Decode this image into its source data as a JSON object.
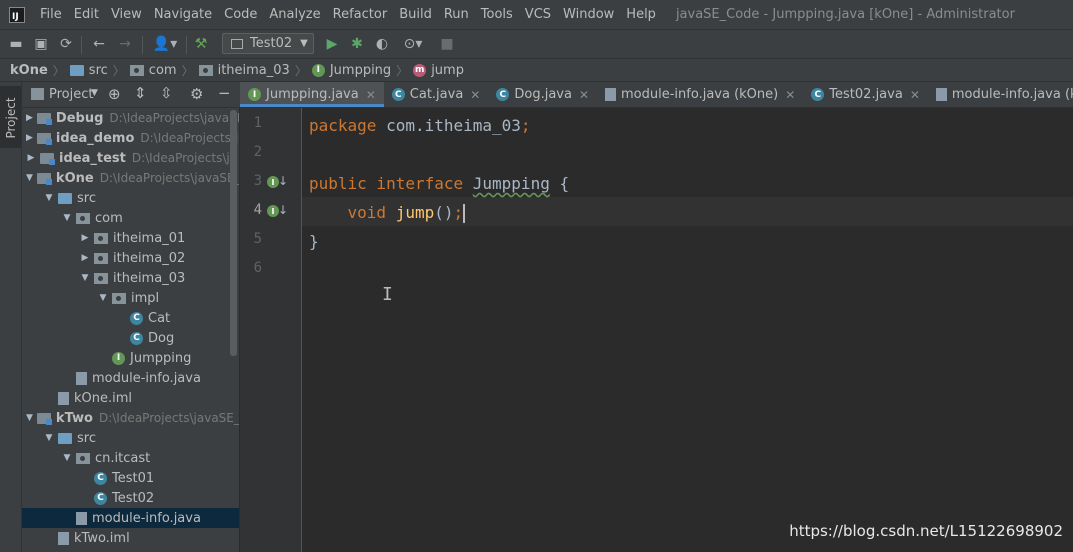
{
  "window": {
    "title": "javaSE_Code - Jumpping.java [kOne] - Administrator",
    "logo_text": "IJ"
  },
  "menu": [
    "File",
    "Edit",
    "View",
    "Navigate",
    "Code",
    "Analyze",
    "Refactor",
    "Build",
    "Run",
    "Tools",
    "VCS",
    "Window",
    "Help"
  ],
  "toolbar": {
    "run_config": "Test02",
    "icons": [
      "open-icon",
      "save-icon",
      "sync-icon",
      "back-icon",
      "forward-icon",
      "user-dropdown-icon",
      "build-hammer-icon",
      "run-icon",
      "debug-icon",
      "coverage-icon",
      "profile-icon",
      "stop-icon"
    ]
  },
  "breadcrumb": [
    "kOne",
    "src",
    "com",
    "itheima_03",
    "Jumpping",
    "jump"
  ],
  "project_panel": {
    "title": "Project",
    "strip_label": "Project",
    "tree": [
      {
        "name": "Debug",
        "path": "D:\\IdeaProjects\\javaSE",
        "icon": "module",
        "arrow": "right",
        "depth": 0,
        "bold": true
      },
      {
        "name": "idea_demo",
        "path": "D:\\IdeaProjects\\ja",
        "icon": "module",
        "arrow": "right",
        "depth": 0,
        "bold": true
      },
      {
        "name": "idea_test",
        "path": "D:\\IdeaProjects\\ja",
        "icon": "module",
        "arrow": "right",
        "depth": 0,
        "bold": true
      },
      {
        "name": "kOne",
        "path": "D:\\IdeaProjects\\javaSE_",
        "icon": "module",
        "arrow": "down",
        "depth": 0,
        "bold": true
      },
      {
        "name": "src",
        "path": "",
        "icon": "folder-blue",
        "arrow": "down",
        "depth": 1,
        "bold": false
      },
      {
        "name": "com",
        "path": "",
        "icon": "package",
        "arrow": "down",
        "depth": 2,
        "bold": false
      },
      {
        "name": "itheima_01",
        "path": "",
        "icon": "package",
        "arrow": "right",
        "depth": 3,
        "bold": false
      },
      {
        "name": "itheima_02",
        "path": "",
        "icon": "package",
        "arrow": "right",
        "depth": 3,
        "bold": false
      },
      {
        "name": "itheima_03",
        "path": "",
        "icon": "package",
        "arrow": "down",
        "depth": 3,
        "bold": false
      },
      {
        "name": "impl",
        "path": "",
        "icon": "package",
        "arrow": "down",
        "depth": 4,
        "bold": false
      },
      {
        "name": "Cat",
        "path": "",
        "icon": "class",
        "arrow": "none",
        "depth": 5,
        "bold": false
      },
      {
        "name": "Dog",
        "path": "",
        "icon": "class",
        "arrow": "none",
        "depth": 5,
        "bold": false
      },
      {
        "name": "Jumpping",
        "path": "",
        "icon": "interface",
        "arrow": "none",
        "depth": 4,
        "bold": false
      },
      {
        "name": "module-info.java",
        "path": "",
        "icon": "file",
        "arrow": "none",
        "depth": 2,
        "bold": false
      },
      {
        "name": "kOne.iml",
        "path": "",
        "icon": "file",
        "arrow": "none",
        "depth": 1,
        "bold": false
      },
      {
        "name": "kTwo",
        "path": "D:\\IdeaProjects\\javaSE_",
        "icon": "module",
        "arrow": "down",
        "depth": 0,
        "bold": true
      },
      {
        "name": "src",
        "path": "",
        "icon": "folder-blue",
        "arrow": "down",
        "depth": 1,
        "bold": false
      },
      {
        "name": "cn.itcast",
        "path": "",
        "icon": "package",
        "arrow": "down",
        "depth": 2,
        "bold": false
      },
      {
        "name": "Test01",
        "path": "",
        "icon": "class",
        "arrow": "none",
        "depth": 3,
        "bold": false
      },
      {
        "name": "Test02",
        "path": "",
        "icon": "class",
        "arrow": "none",
        "depth": 3,
        "bold": false
      },
      {
        "name": "module-info.java",
        "path": "",
        "icon": "file",
        "arrow": "none",
        "depth": 2,
        "bold": false,
        "selected": true
      },
      {
        "name": "kTwo.iml",
        "path": "",
        "icon": "file",
        "arrow": "none",
        "depth": 1,
        "bold": false
      }
    ]
  },
  "editor_tabs": [
    {
      "label": "Jumpping.java",
      "icon": "interface",
      "active": true
    },
    {
      "label": "Cat.java",
      "icon": "class",
      "active": false
    },
    {
      "label": "Dog.java",
      "icon": "class",
      "active": false
    },
    {
      "label": "module-info.java (kOne)",
      "icon": "file",
      "active": false
    },
    {
      "label": "Test02.java",
      "icon": "class",
      "active": false
    },
    {
      "label": "module-info.java (kTwo)",
      "icon": "file",
      "active": false
    }
  ],
  "code": {
    "line_numbers": [
      "1",
      "2",
      "3",
      "4",
      "5",
      "6"
    ],
    "lines": [
      {
        "parts": [
          {
            "t": "package ",
            "c": "kw"
          },
          {
            "t": "com.itheima_03",
            "c": "plain"
          },
          {
            "t": ";",
            "c": "kw"
          }
        ]
      },
      {
        "parts": []
      },
      {
        "parts": [
          {
            "t": "public interface ",
            "c": "kw"
          },
          {
            "t": "Jumpping",
            "c": "type-name"
          },
          {
            "t": " {",
            "c": "plain"
          }
        ]
      },
      {
        "parts": [
          {
            "t": "    void ",
            "c": "kw"
          },
          {
            "t": "jump",
            "c": "method-name"
          },
          {
            "t": "()",
            "c": "plain"
          },
          {
            "t": ";",
            "c": "kw"
          }
        ],
        "caret": true
      },
      {
        "parts": [
          {
            "t": "}",
            "c": "plain"
          }
        ]
      },
      {
        "parts": []
      }
    ],
    "gutter_marks": [
      {
        "line": 3,
        "label": "I"
      },
      {
        "line": 4,
        "label": "I"
      }
    ]
  },
  "watermark": "https://blog.csdn.net/L15122698902"
}
